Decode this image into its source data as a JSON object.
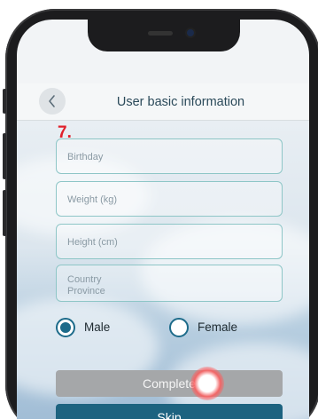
{
  "header": {
    "title": "User basic information",
    "back_icon": "chevron-left-icon"
  },
  "step_label": "7.",
  "form": {
    "birthday_placeholder": "Birthday",
    "weight_placeholder": "Weight (kg)",
    "height_placeholder": "Height (cm)",
    "country_placeholder": "Country",
    "province_placeholder": "Province"
  },
  "gender": {
    "options": [
      "Male",
      "Female"
    ],
    "selected": "Male"
  },
  "buttons": {
    "complete_label": "Complete",
    "skip_label": "Skip"
  },
  "colors": {
    "accent": "#1d6380",
    "field_border": "#8ec6c7",
    "step_label": "#e0212b",
    "disabled_button": "#a5a7a9"
  }
}
